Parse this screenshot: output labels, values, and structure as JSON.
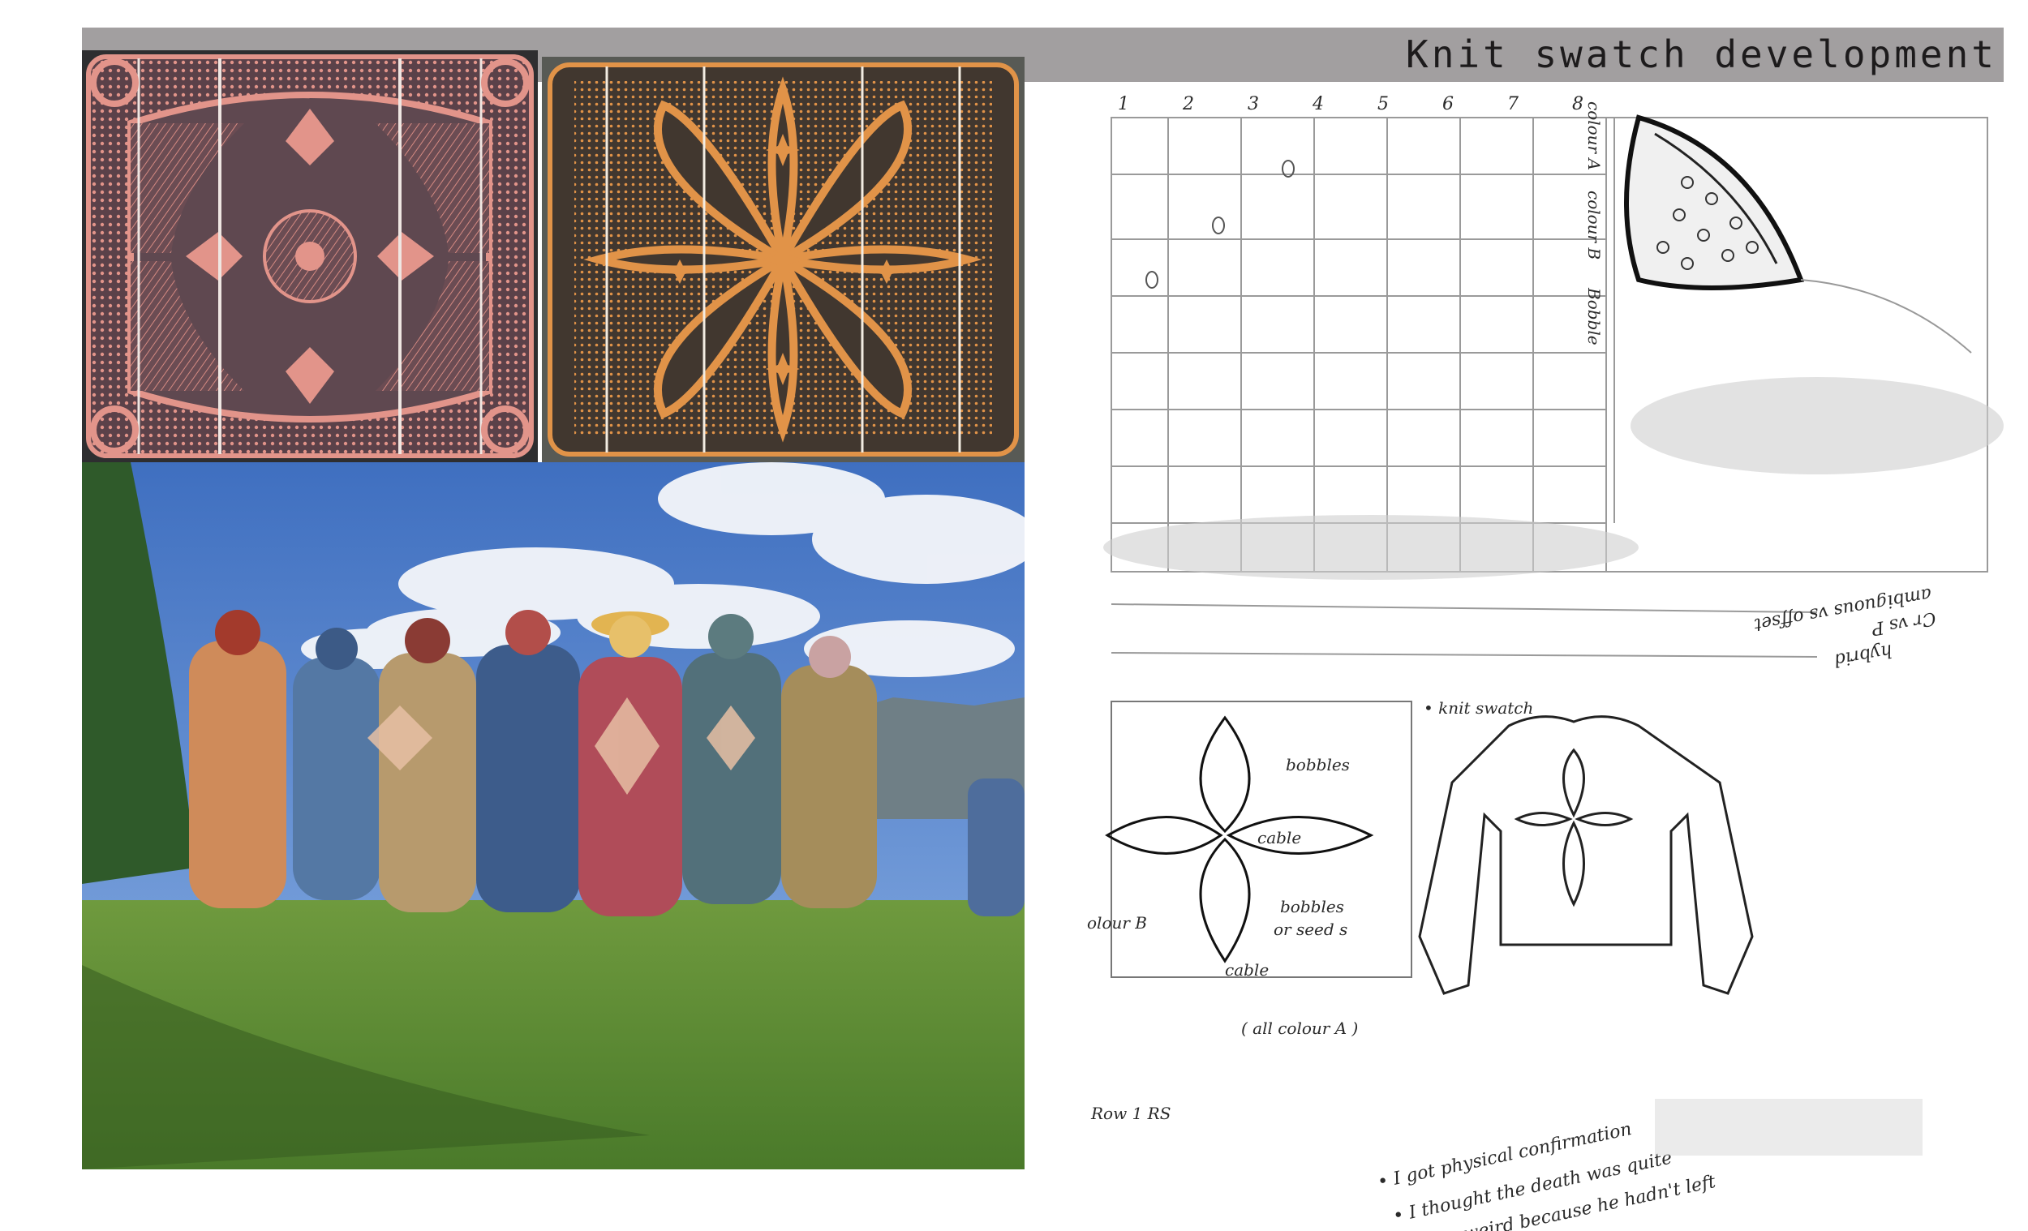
{
  "page": {
    "title": "Knit swatch development"
  },
  "images": {
    "blanket_pink": {
      "icon": "basotho-blanket-pink-pattern-photo",
      "colors": {
        "base": "#5b4149",
        "pattern": "#e2948a"
      }
    },
    "blanket_orange": {
      "icon": "basotho-blanket-orange-pattern-photo",
      "colors": {
        "base": "#41372f",
        "pattern": "#e19348"
      }
    },
    "people_photo": {
      "icon": "people-wearing-blankets-landscape-photo",
      "colors": {
        "sky": "#4f7ac2",
        "grass": "#5f8a35"
      }
    },
    "sketch": {
      "icon": "knit-swatch-pencil-sketch"
    }
  },
  "sketch_notes": {
    "chart_numbers": [
      "1",
      "2",
      "3",
      "4",
      "5",
      "6",
      "7",
      "8"
    ],
    "legend_a": "colour A",
    "legend_b": "colour B",
    "legend_bobble": "Bobble",
    "bobbles": "bobbles",
    "cable": "cable",
    "bobbles_or_seed": "bobbles",
    "or_seed": "or seed s",
    "cable_bottom": "cable",
    "all_colour": "( all colour A )",
    "colour_b_side": "olour B",
    "knit_swatch": "• knit swatch",
    "row_label": "Row 1 RS",
    "note_1": "• I got physical confirmation",
    "note_2": "• I thought the death was quite",
    "note_3": "weird because he hadn't left",
    "upside_1": "Cr vs P",
    "upside_2": "ambiguous vs offset",
    "upside_3": "hybrid"
  }
}
